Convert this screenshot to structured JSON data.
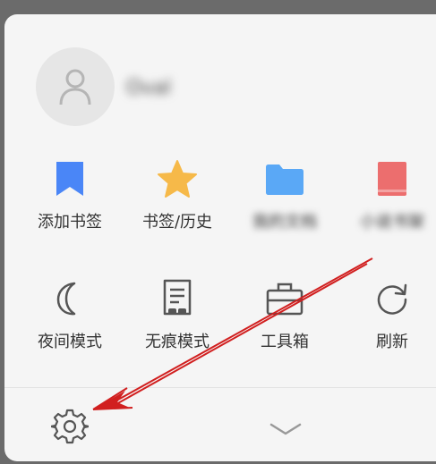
{
  "profile": {
    "username": "Oval",
    "avatar_icon": "user-icon"
  },
  "grid_row1": [
    {
      "label": "添加书签",
      "icon": "bookmark-icon",
      "color": "#4a86f7"
    },
    {
      "label": "书签/历史",
      "icon": "star-icon",
      "color": "#f6b949"
    },
    {
      "label": "我的文档",
      "icon": "folder-icon",
      "color": "#5aa8f6"
    },
    {
      "label": "小说书架",
      "icon": "book-icon",
      "color": "#ec6e6e"
    }
  ],
  "grid_row2": [
    {
      "label": "夜间模式",
      "icon": "moon-icon"
    },
    {
      "label": "无痕模式",
      "icon": "incognito-icon"
    },
    {
      "label": "工具箱",
      "icon": "toolbox-icon"
    },
    {
      "label": "刷新",
      "icon": "refresh-icon"
    }
  ],
  "bottom": {
    "settings_icon": "gear-icon",
    "collapse_icon": "chevron-down-icon"
  },
  "annotation": {
    "arrow_color": "#d11f1f"
  }
}
